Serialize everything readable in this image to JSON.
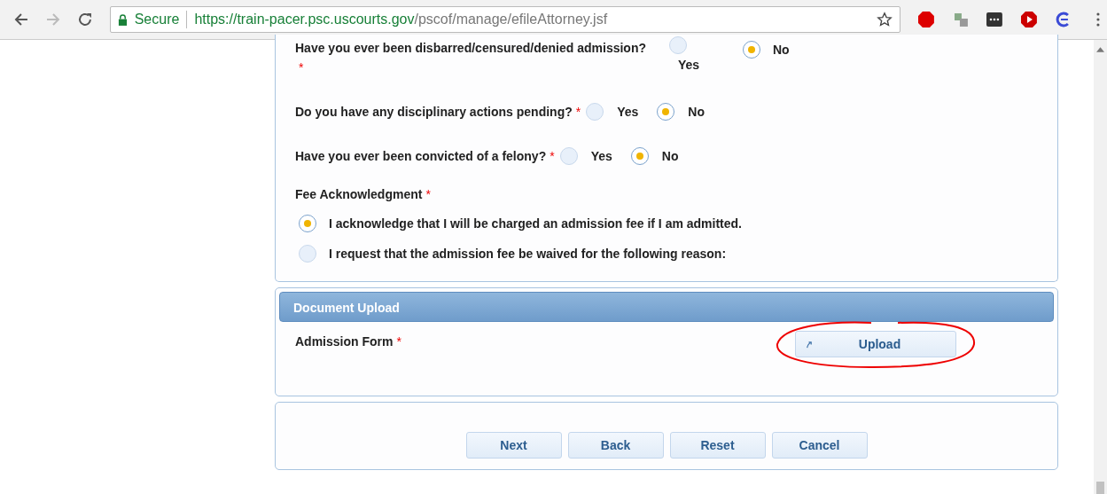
{
  "browser": {
    "security_label": "Secure",
    "url_host": "https://train-pacer.psc.uscourts.gov",
    "url_path": "/pscof/manage/efileAttorney.jsf"
  },
  "questions": [
    {
      "kind": "wrapped",
      "label": "Have you ever been disbarred/censured/denied admission?",
      "required": "*",
      "options": [
        {
          "label": "Yes",
          "selected": false
        },
        {
          "label": "No",
          "selected": true
        }
      ]
    },
    {
      "kind": "inline",
      "label": "Do you have any disciplinary actions pending?",
      "required": "*",
      "options": [
        {
          "label": "Yes",
          "selected": false
        },
        {
          "label": "No",
          "selected": true
        }
      ]
    },
    {
      "kind": "inline",
      "label": "Have you ever been convicted of a felony?",
      "required": "*",
      "options": [
        {
          "label": "Yes",
          "selected": false
        },
        {
          "label": "No",
          "selected": true
        }
      ]
    }
  ],
  "fee": {
    "label": "Fee Acknowledgment",
    "required": "*",
    "options": [
      {
        "label": "I acknowledge that I will be charged an admission fee if I am admitted.",
        "selected": true
      },
      {
        "label": "I request that the admission fee be waived for the following reason:",
        "selected": false
      }
    ]
  },
  "document_upload": {
    "title": "Document Upload",
    "field_label": "Admission Form",
    "required": "*",
    "button": "Upload"
  },
  "buttons": [
    "Next",
    "Back",
    "Reset",
    "Cancel"
  ]
}
